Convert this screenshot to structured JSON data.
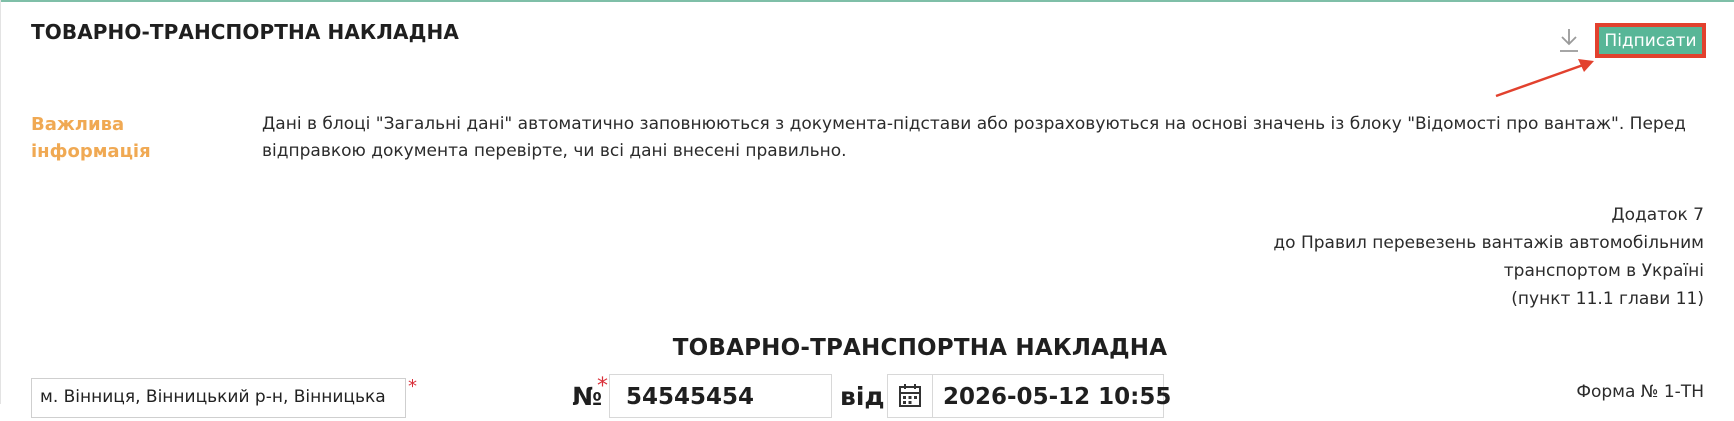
{
  "header": {
    "title": "ТОВАРНО-ТРАНСПОРТНА НАКЛАДНА",
    "download_icon": "download-icon",
    "sign_label": "Підписати"
  },
  "colors": {
    "accent": "#58b697",
    "highlight": "#e2412e",
    "info_label": "#f0a953"
  },
  "info": {
    "label_line1": "Важлива",
    "label_line2": "інформація",
    "text": "Дані в блоці \"Загальні дані\" автоматично заповнюються з документа-підстави або розраховуються на основі значень із блоку \"Відомості про вантаж\". Перед відправкою документа перевірте, чи всі дані внесені правильно."
  },
  "appendix": {
    "line1": "Додаток 7",
    "line2": "до Правил перевезень вантажів автомобільним",
    "line3": "транспортом в Україні",
    "line4": "(пункт 11.1 глави 11)"
  },
  "document": {
    "title": "ТОВАРНО-ТРАНСПОРТНА НАКЛАДНА",
    "location_value": "м. Вінниця, Вінницький р-н, Вінницька",
    "required_mark": "*",
    "number_label": "№",
    "number_value": "54545454",
    "from_label": "від",
    "calendar_icon": "calendar-icon",
    "date_value": "2026-05-12 10:55",
    "form_number": "Форма № 1-ТН"
  }
}
